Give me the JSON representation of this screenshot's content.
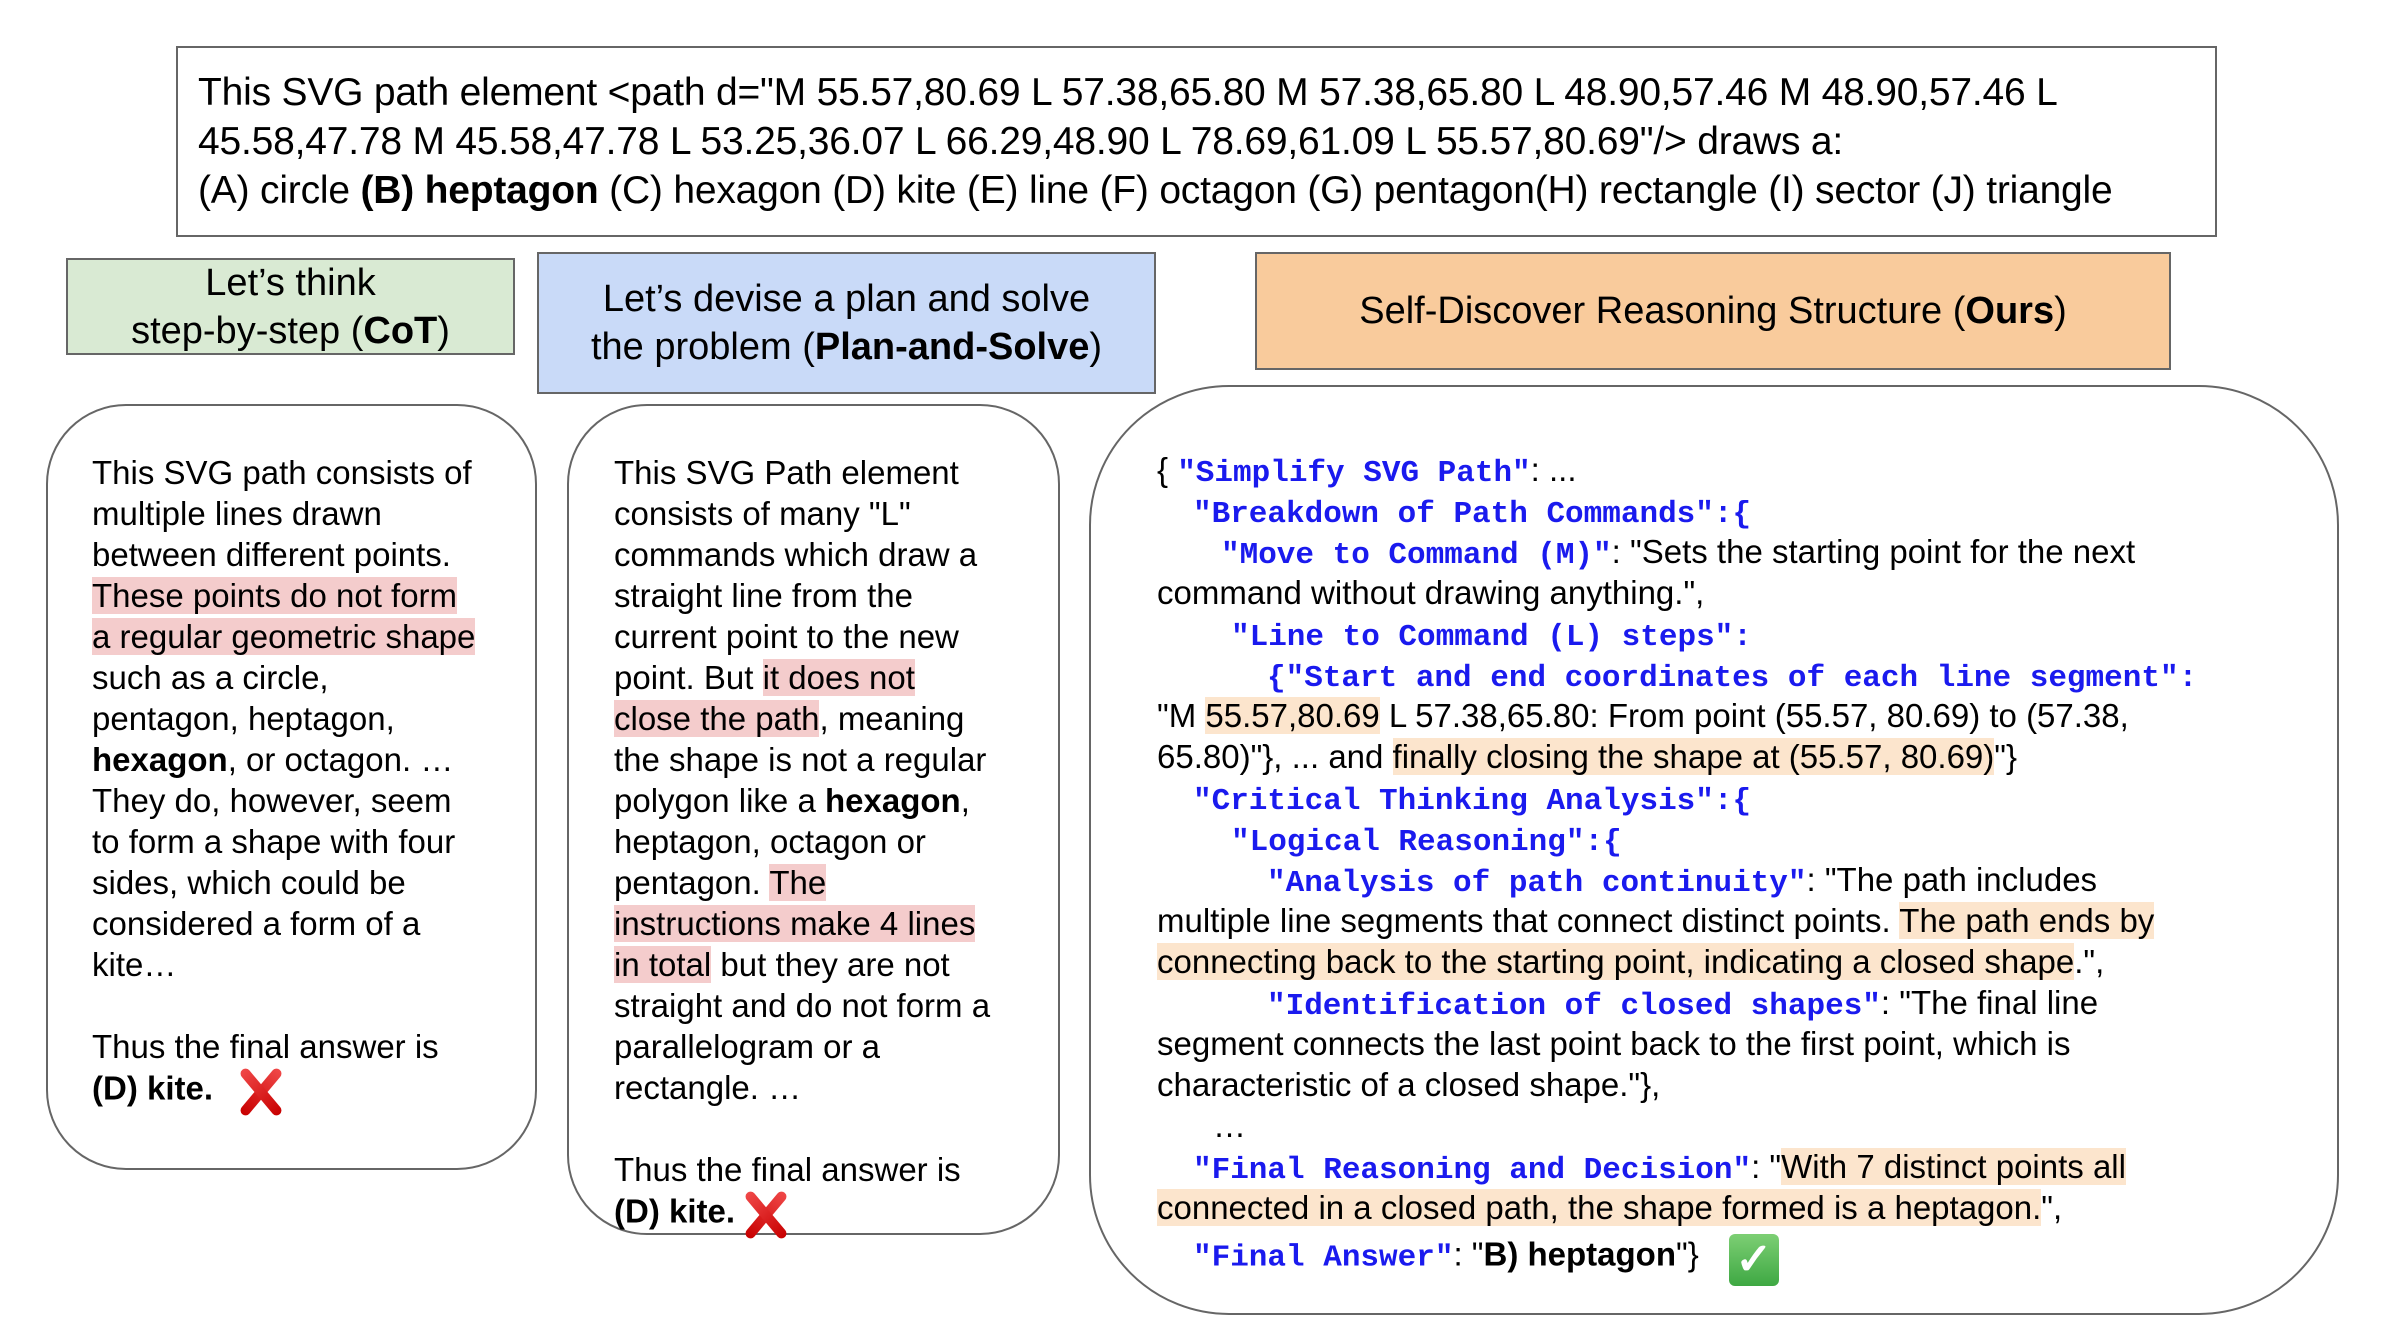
{
  "question": {
    "lines": [
      "This SVG path element <path d=\"M 55.57,80.69 L 57.38,65.80 M 57.38,65.80 L 48.90,57.46 M 48.90,57.46 L",
      "45.58,47.78 M 45.58,47.78 L 53.25,36.07 L 66.29,48.90 L 78.69,61.09 L 55.57,80.69\"/> draws a:"
    ],
    "options_prefix": "(A) circle ",
    "options_correct": "(B) heptagon",
    "options_suffix": " (C) hexagon (D) kite (E) line (F) octagon (G) pentagon(H) rectangle (I) sector (J) triangle"
  },
  "headers": {
    "cot": {
      "line1": "Let’s think",
      "line2_pre": "step-by-step (",
      "line2_bold": "CoT",
      "line2_post": ")"
    },
    "plan_solve": {
      "line1": "Let’s devise a plan and solve",
      "line2_pre": "the problem (",
      "line2_bold": "Plan-and-Solve",
      "line2_post": ")"
    },
    "ours": {
      "pre": "Self-Discover Reasoning Structure (",
      "bold": "Ours",
      "post": ")"
    }
  },
  "cot_panel": {
    "l1": "This SVG path consists of",
    "l2": "multiple lines drawn",
    "l3": "between different points.",
    "l4_hl": "These points do not form",
    "l5_hl": "a regular geometric shape",
    "l6": "such as a circle,",
    "l7": "pentagon, heptagon,",
    "l8_bold": "hexagon",
    "l8_rest": ", or octagon. …",
    "l9": "They do, however, seem",
    "l10": "to form a shape with four",
    "l11": "sides, which could be",
    "l12": "considered a form of a",
    "l13": "kite…",
    "final": "Thus the final answer is",
    "answer": "(D) kite.",
    "result_icon": "cross-mark"
  },
  "plan_panel": {
    "l1": "This SVG Path element",
    "l2": "consists of many \"L\"",
    "l3": "commands which draw a",
    "l4": "straight line from the",
    "l5": "current point to the new",
    "l6_pre": "point. But ",
    "l6_hl": "it does not",
    "l7_hl": "close the path",
    "l7_post": ", meaning",
    "l8": "the shape is not a regular",
    "l9_pre": "polygon like a ",
    "l9_bold": "hexagon",
    "l9_post": ",",
    "l10": "heptagon, octagon or",
    "l11_pre": "pentagon. ",
    "l11_hl": "The",
    "l12_hl": "instructions make 4 lines",
    "l13_hl": "in total",
    "l13_post": " but they are not",
    "l14": "straight and do not form a",
    "l15": "parallelogram or a",
    "l16": "rectangle. …",
    "final": "Thus the final answer is",
    "answer": "(D) kite.",
    "result_icon": "cross-mark"
  },
  "ours_panel": {
    "open": "{ ",
    "k_simplify": "\"Simplify SVG Path\"",
    "v_simplify": ": ...",
    "k_breakdown": "\"Breakdown of Path Commands\"",
    "brace": ":{",
    "k_move": "\"Move to Command (M)\"",
    "v_move1": ": \"Sets the starting point for the next",
    "v_move2": "command without drawing anything.\",",
    "k_line": "\"Line to Command (L) steps\"",
    "colon": ":",
    "k_start_pre": "{",
    "k_start": "\"Start and end coordinates of each line segment\"",
    "v_start1_pre": "\"M ",
    "v_start1_hl": "55.57,80.69",
    "v_start1_post": " L 57.38,65.80: From point (55.57, 80.69) to (57.38,",
    "v_start2_pre": "65.80)\"}, ... and ",
    "v_start2_hl": "finally closing the shape at (55.57, 80.69)",
    "v_start2_post": "\"}",
    "k_critical": "\"Critical Thinking Analysis\"",
    "k_logical": "\"Logical Reasoning\"",
    "k_continuity": "\"Analysis of path continuity\"",
    "v_cont1": ": \"The path includes",
    "v_cont2_pre": "multiple line segments that connect distinct points. ",
    "v_cont2_hl": "The path ends by",
    "v_cont3_hl": "connecting back to the starting point, indicating a closed shape",
    "v_cont3_post": ".\",",
    "k_closed": "\"Identification of closed shapes\"",
    "v_closed1": ": \"The final line",
    "v_closed2": "segment connects the last point back to the first point, which is",
    "v_closed3": "characteristic of a closed shape.\"},",
    "ellipsis": "…",
    "k_final_reason": "\"Final Reasoning and Decision\"",
    "v_fr1_pre": ": \"",
    "v_fr1_hl": "With 7 distinct points all",
    "v_fr2_hl": "connected in a closed path, the shape formed is a heptagon.",
    "v_fr2_post": "\",",
    "k_answer": "\"Final Answer\"",
    "v_answer_pre": ": \"",
    "v_answer_bold": "B) heptagon",
    "v_answer_post": "\"}",
    "result_icon": "check-mark"
  },
  "colors": {
    "cot_header_bg": "#d9ead3",
    "plan_header_bg": "#c9daf8",
    "ours_header_bg": "#f9cb9c",
    "error_highlight": "#f4cccc",
    "correct_highlight": "#fce5cd",
    "json_key": "#1a1aee"
  }
}
